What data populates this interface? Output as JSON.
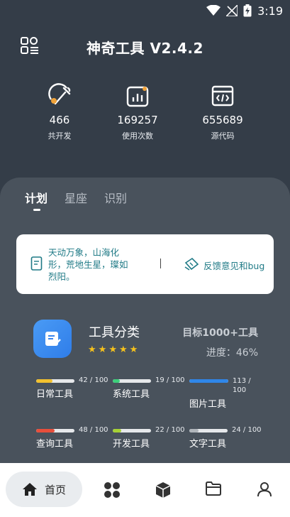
{
  "status_bar": {
    "time": "3:19"
  },
  "header": {
    "title": "神奇工具 V2.4.2",
    "menu_icon": "menu-grid-icon"
  },
  "stats": [
    {
      "icon": "wrench-icon",
      "value": "466",
      "label": "共开发"
    },
    {
      "icon": "chart-icon",
      "value": "169257",
      "label": "使用次数"
    },
    {
      "icon": "code-icon",
      "value": "655689",
      "label": "源代码"
    }
  ],
  "tabs": [
    {
      "label": "计划",
      "active": true
    },
    {
      "label": "星座",
      "active": false
    },
    {
      "label": "识别",
      "active": false
    }
  ],
  "quote_card": {
    "quote": "天动万象，山海化形，荒地生星，璨如烈阳。",
    "separator": "|",
    "feedback_label": "反馈意见和bug"
  },
  "category": {
    "title": "工具分类",
    "rating_stars": 5,
    "goal": "目标1000+工具",
    "progress": "进度：46%"
  },
  "tools": [
    {
      "name": "日常工具",
      "count": "42 / 100",
      "fraction": 0.42,
      "color": "#f2c12e"
    },
    {
      "name": "系统工具",
      "count": "19 / 100",
      "fraction": 0.19,
      "color": "#3ccf7a"
    },
    {
      "name": "图片工具",
      "count": "113 / 100",
      "fraction": 1.0,
      "color": "#2f86e9"
    },
    {
      "name": "查询工具",
      "count": "48 / 100",
      "fraction": 0.48,
      "color": "#e84e3b"
    },
    {
      "name": "开发工具",
      "count": "22 / 100",
      "fraction": 0.22,
      "color": "#a6d135"
    },
    {
      "name": "文字工具",
      "count": "24 / 100",
      "fraction": 0.24,
      "color": "#b0b5bb"
    }
  ],
  "bottom_nav": {
    "home_label": "首页",
    "items": [
      "home-icon",
      "apps-icon",
      "cube-icon",
      "folder-icon",
      "user-icon"
    ]
  }
}
